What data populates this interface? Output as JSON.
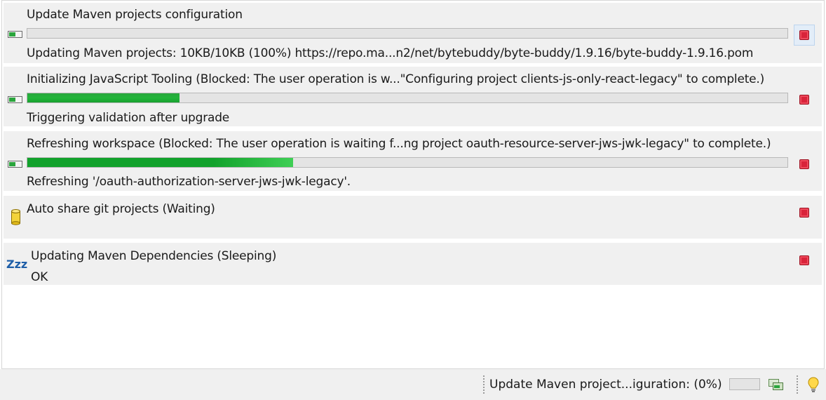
{
  "jobs": [
    {
      "title": "Update Maven projects configuration",
      "subtask": "Updating Maven projects: 10KB/10KB (100%) https://repo.ma...n2/net/bytebuddy/byte-buddy/1.9.16/byte-buddy-1.9.16.pom",
      "progress": 0.0,
      "icon": "progress-task-icon"
    },
    {
      "title": "Initializing JavaScript Tooling (Blocked: The user operation is w...\"Configuring project clients-js-only-react-legacy\" to complete.)",
      "subtask": "Triggering validation after upgrade",
      "progress": 0.2,
      "icon": "progress-task-icon"
    },
    {
      "title": "Refreshing workspace (Blocked: The user operation is waiting f...ng project oauth-resource-server-jws-jwk-legacy\" to complete.)",
      "subtask": "Refreshing '/oauth-authorization-server-jws-jwk-legacy'.",
      "progress": 0.35,
      "icon": "progress-task-icon"
    },
    {
      "title": "Auto share git projects (Waiting)",
      "subtask": "",
      "icon": "waiting-cylinder-icon"
    },
    {
      "title": "Updating Maven Dependencies (Sleeping)",
      "subtask": "OK",
      "icon": "sleeping-zzz-icon"
    }
  ],
  "status_bar": {
    "text": "Update Maven project...iguration: (0%)",
    "progress": 0.0
  },
  "colors": {
    "progress_green": "#22b53a",
    "stop_red": "#d9233a",
    "zzz_blue": "#1f5fa8"
  }
}
